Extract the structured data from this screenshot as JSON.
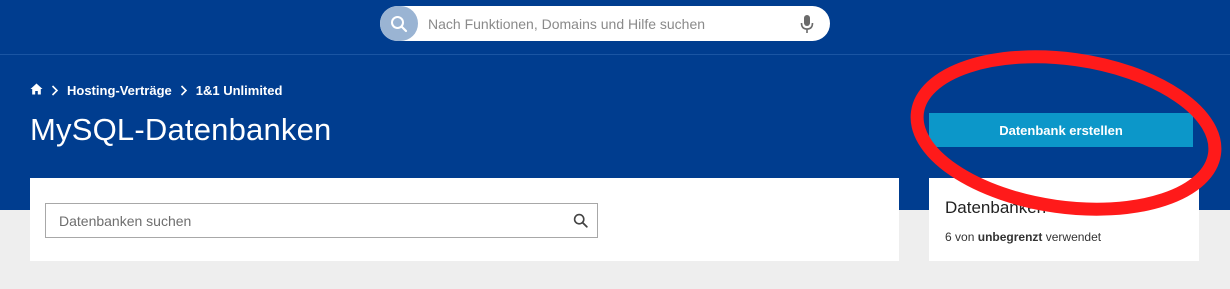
{
  "colors": {
    "header_bg": "#003d8f",
    "primary_button": "#0c97c9",
    "annotation": "#ff1a1a",
    "page_bg": "#eeeeee"
  },
  "global_search": {
    "placeholder": "Nach Funktionen, Domains und Hilfe suchen",
    "search_icon": "search-icon",
    "mic_icon": "microphone-icon"
  },
  "breadcrumb": {
    "home_icon": "home-icon",
    "items": [
      "Hosting-Verträge",
      "1&1 Unlimited"
    ]
  },
  "page_title": "MySQL-Datenbanken",
  "primary_action": {
    "label": "Datenbank erstellen"
  },
  "db_search": {
    "placeholder": "Datenbanken suchen"
  },
  "usage_card": {
    "title": "Datenbanken",
    "count": "6",
    "text_von": "von",
    "limit": "unbegrenzt",
    "text_used": "verwendet"
  }
}
